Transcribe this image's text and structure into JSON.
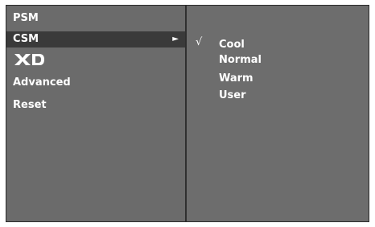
{
  "left_menu": {
    "items": [
      {
        "label": "PSM",
        "selected": false
      },
      {
        "label": "CSM",
        "selected": true
      },
      {
        "label": "XD",
        "selected": false,
        "type": "logo"
      },
      {
        "label": "Advanced",
        "selected": false
      },
      {
        "label": "Reset",
        "selected": false
      }
    ],
    "submenu_indicator": "►"
  },
  "right_menu": {
    "check_mark": "√",
    "items": [
      {
        "label": "Cool",
        "checked": true
      },
      {
        "label": "Normal",
        "checked": false
      },
      {
        "label": "Warm",
        "checked": false
      },
      {
        "label": "User",
        "checked": false
      }
    ]
  },
  "colors": {
    "panel_bg": "#6b6b6b",
    "highlight_bg": "#3a3a3a",
    "text": "#ffffff",
    "border": "#2a2a2a"
  }
}
